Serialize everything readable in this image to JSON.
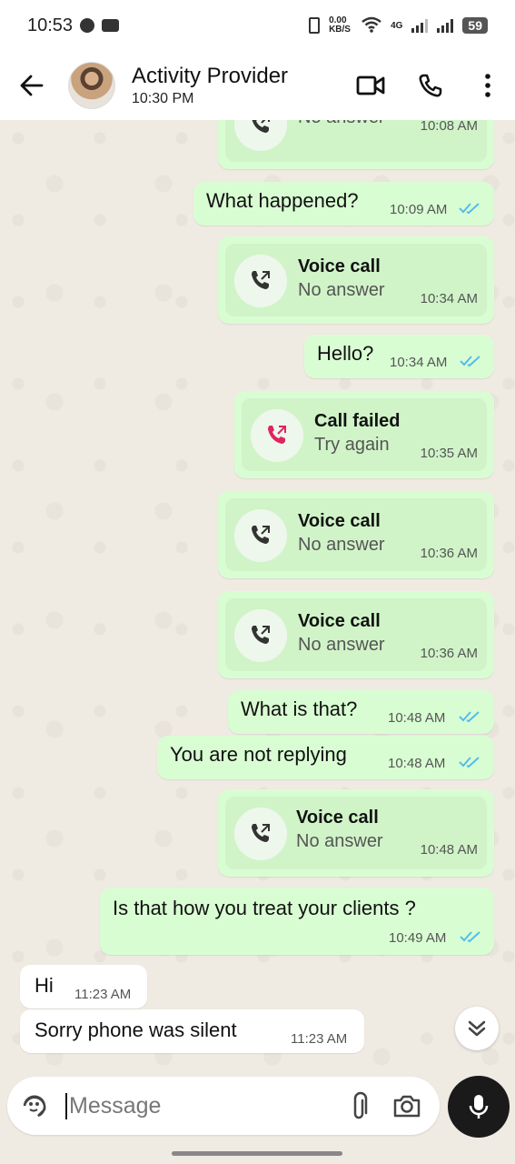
{
  "status_bar": {
    "time": "10:53",
    "net_speed": "0.00 KB/S",
    "net_type": "4G",
    "battery": "59"
  },
  "header": {
    "contact_name": "Activity Provider",
    "contact_status": "10:30 PM"
  },
  "messages": [
    {
      "kind": "call",
      "title": "",
      "subtitle": "No answer",
      "time": "10:08 AM"
    },
    {
      "kind": "text",
      "text": "What happened?",
      "time": "10:09 AM",
      "read": true
    },
    {
      "kind": "call",
      "title": "Voice call",
      "subtitle": "No answer",
      "time": "10:34 AM"
    },
    {
      "kind": "text",
      "text": "Hello?",
      "time": "10:34 AM",
      "read": true
    },
    {
      "kind": "call_failed",
      "title": "Call failed",
      "subtitle": "Try again",
      "time": "10:35 AM"
    },
    {
      "kind": "call",
      "title": "Voice call",
      "subtitle": "No answer",
      "time": "10:36 AM"
    },
    {
      "kind": "call",
      "title": "Voice call",
      "subtitle": "No answer",
      "time": "10:36 AM"
    },
    {
      "kind": "text",
      "text": "What is that?",
      "time": "10:48 AM",
      "read": true
    },
    {
      "kind": "text",
      "text": "You are not replying",
      "time": "10:48 AM",
      "read": true
    },
    {
      "kind": "call",
      "title": "Voice call",
      "subtitle": "No answer",
      "time": "10:48 AM"
    },
    {
      "kind": "text",
      "text": "Is that how you treat your clients ?",
      "time": "10:49 AM",
      "read": true
    },
    {
      "kind": "incoming",
      "text": "Hi",
      "time": "11:23 AM"
    },
    {
      "kind": "incoming",
      "text": "Sorry phone was silent",
      "time": "11:23 AM"
    }
  ],
  "composer": {
    "placeholder": "Message"
  },
  "colors": {
    "outgoing_bubble": "#d9fdd3",
    "incoming_bubble": "#ffffff",
    "read_ticks": "#53bdeb",
    "call_failed_icon": "#e0245e"
  },
  "icons": {
    "back": "arrow-left-icon",
    "video": "video-camera-icon",
    "phone": "phone-icon",
    "menu": "more-vert-icon",
    "call_out": "outgoing-call-icon",
    "sticker": "sticker-icon",
    "attach": "paperclip-icon",
    "camera": "camera-icon",
    "mic": "mic-icon",
    "scroll_down": "double-chevron-down-icon"
  }
}
